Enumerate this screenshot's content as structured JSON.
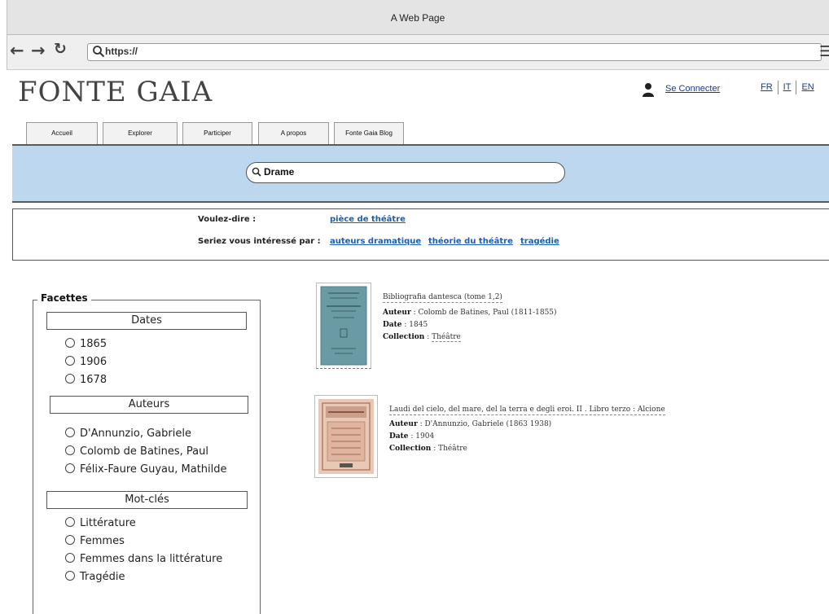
{
  "window": {
    "title": "A Web Page"
  },
  "browser": {
    "url": "https://"
  },
  "header": {
    "logo": "FONTE GAIA",
    "login_label": "Se Connecter",
    "languages": [
      "FR",
      "IT",
      "EN"
    ]
  },
  "tabs": [
    "Accueil",
    "Explorer",
    "Participer",
    "A propos",
    "Fonte Gaia Blog"
  ],
  "search": {
    "query": "Drame"
  },
  "suggestions": {
    "did_you_mean_label": "Voulez-dire :",
    "did_you_mean": "pièce de théâtre",
    "interested_label": "Seriez vous intéressé par :",
    "interested": [
      "auteurs dramatique",
      "théorie du théâtre",
      "tragédie"
    ]
  },
  "facets": {
    "title": "Facettes",
    "groups": [
      {
        "label": "Dates",
        "options": [
          "1865",
          "1906",
          "1678"
        ]
      },
      {
        "label": "Auteurs",
        "options": [
          "D'Annunzio, Gabriele",
          "Colomb de Batines, Paul",
          "Félix-Faure Guyau, Mathilde"
        ]
      },
      {
        "label": "Mot-clés",
        "options": [
          "Littérature",
          "Femmes",
          "Femmes dans la littérature",
          "Tragédie"
        ]
      }
    ]
  },
  "results": [
    {
      "title": "Bibliografia dantesca (tome 1,2)",
      "author_label": "Auteur",
      "author": "Colomb de Batines, Paul (1811-1855)",
      "date_label": "Date",
      "date": "1845",
      "collection_label": "Collection",
      "collection": "Théâtre"
    },
    {
      "title": "Laudi del cielo, del mare, del la terra e degli eroi. II . Libro terzo : Alcione",
      "author_label": "Auteur",
      "author": "D'Annunzio, Gabriele (1863 1938)",
      "date_label": "Date",
      "date": "1904",
      "collection_label": "Collection",
      "collection": "Théâtre"
    }
  ],
  "colors": {
    "band": "#bdd7ee",
    "link": "#1a5fb4"
  }
}
